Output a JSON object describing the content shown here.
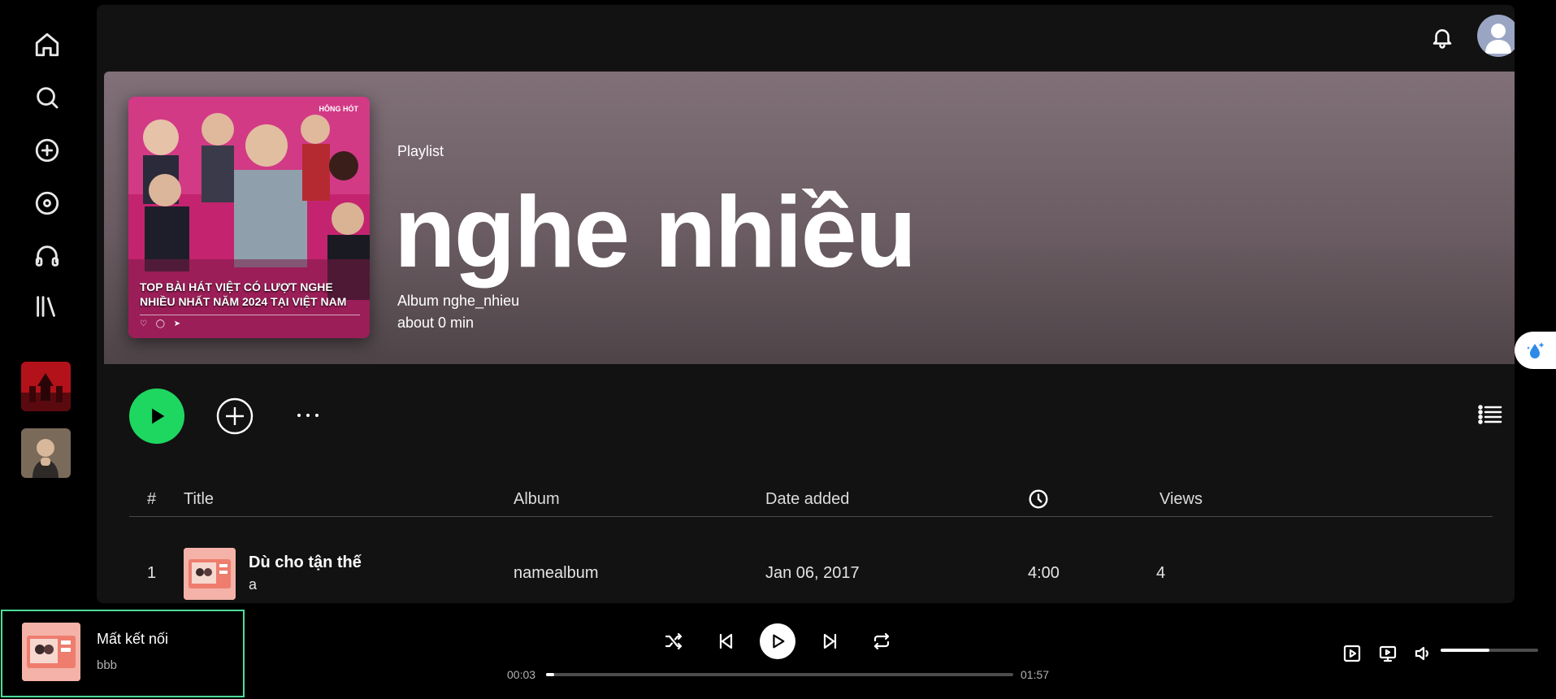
{
  "sidebar": {
    "icons": [
      "home-icon",
      "search-icon",
      "add-icon",
      "disc-icon",
      "headphones-icon",
      "library-icon"
    ]
  },
  "topbar": {
    "icons": [
      "bell-icon",
      "user-avatar"
    ]
  },
  "playlist": {
    "type": "Playlist",
    "title": "nghe nhiều",
    "album_line": "Album nghe_nhieu",
    "duration_line": "about 0 min",
    "cover_caption": "TOP BÀI HÁT VIỆT CÓ LƯỢT NGHE NHIỀU NHẤT NĂM 2024 TẠI VIỆT NAM",
    "cover_badge": "HÔNG HÓT",
    "cover_icons": "♡ ◯ ➤"
  },
  "table": {
    "headers": {
      "index": "#",
      "title": "Title",
      "album": "Album",
      "date_added": "Date added",
      "views": "Views"
    },
    "rows": [
      {
        "index": "1",
        "title": "Dù cho tận thế",
        "artist": "a",
        "album": "namealbum",
        "date_added": "Jan 06, 2017",
        "duration": "4:00",
        "views": "4"
      }
    ]
  },
  "player": {
    "now_title": "Mất kết nối",
    "now_artist": "bbb",
    "elapsed": "00:03",
    "total": "01:57",
    "progress_fraction": 0.017,
    "volume_fraction": 0.5
  },
  "colors": {
    "accent": "#1ed760",
    "now_playing_border": "#4ade9a",
    "background": "#121212"
  }
}
